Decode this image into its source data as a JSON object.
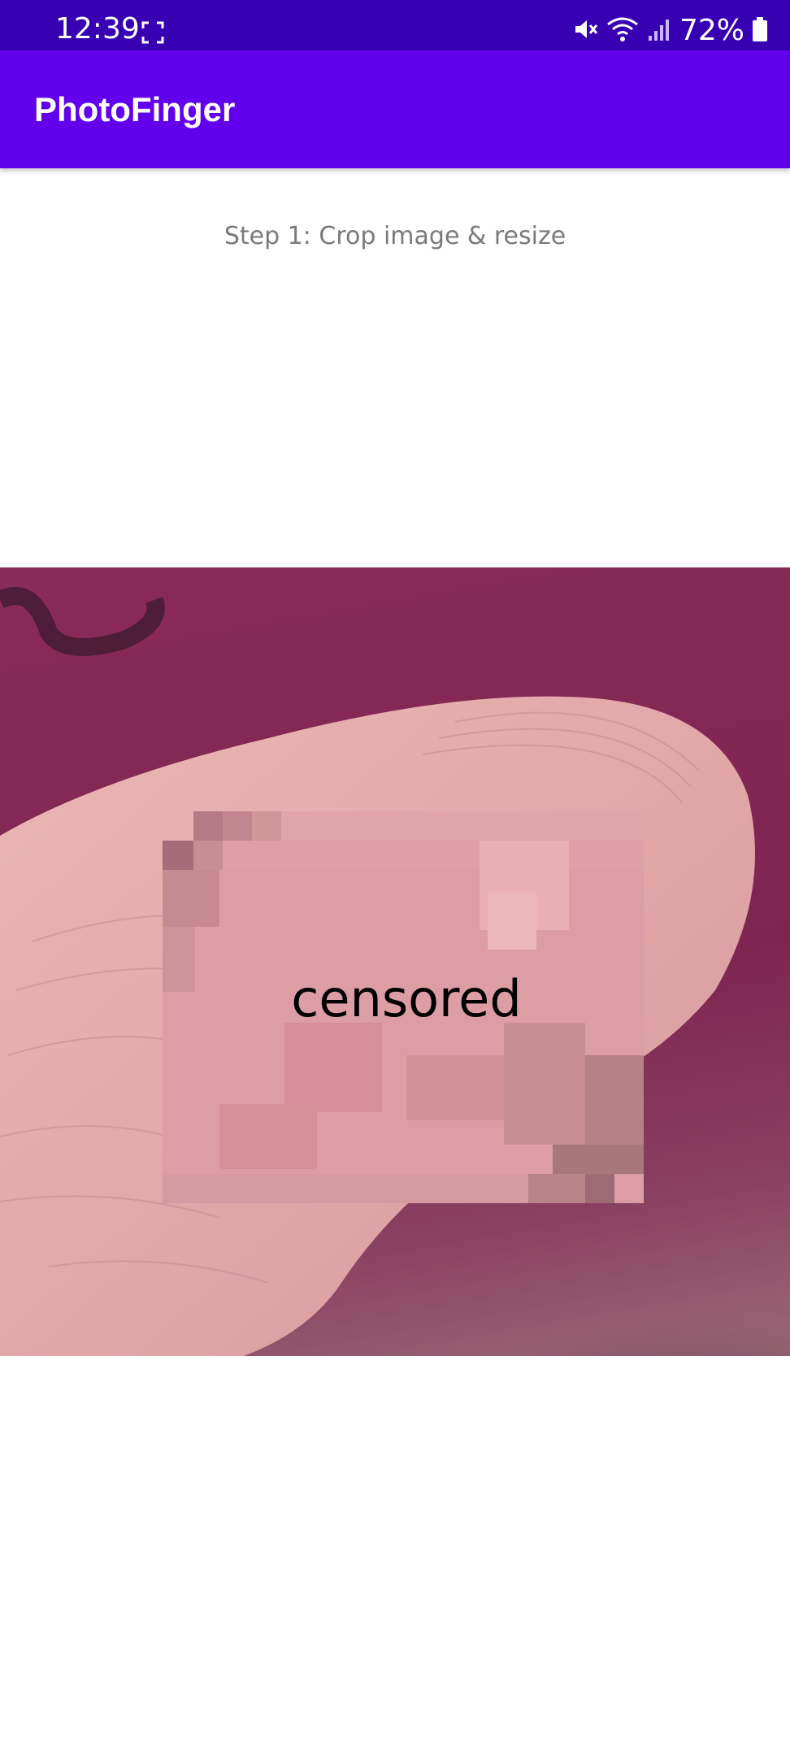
{
  "status_bar": {
    "time": "12:39",
    "battery": "72%",
    "icons": [
      "screenshot-icon",
      "mute-icon",
      "wifi-icon",
      "signal-icon",
      "battery-icon"
    ]
  },
  "app_bar": {
    "title": "PhotoFinger",
    "color": "#6200ee",
    "status_color": "#3700b3"
  },
  "main": {
    "step_text": "Step 1: Crop image & resize",
    "photo": {
      "censored_label": "censored"
    }
  }
}
